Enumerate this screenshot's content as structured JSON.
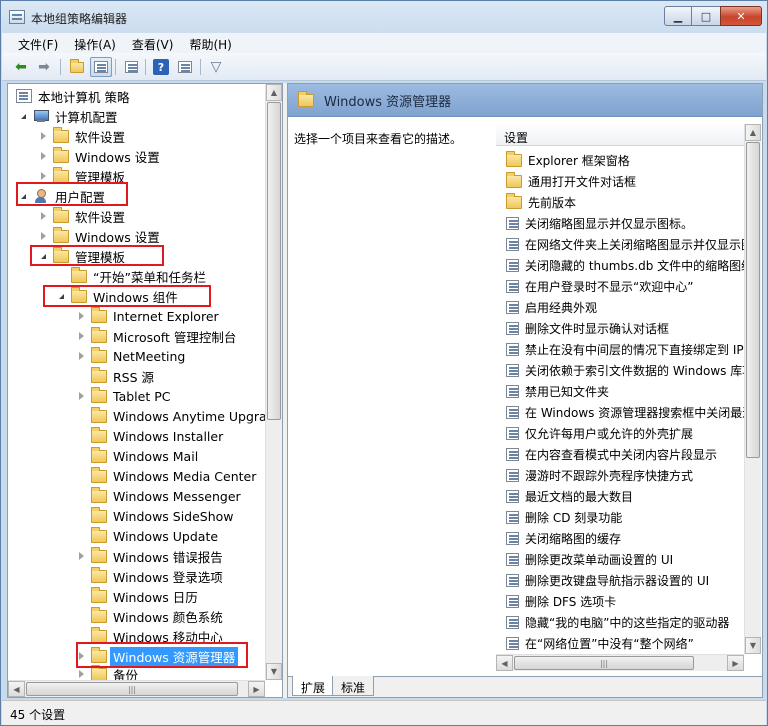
{
  "window": {
    "title": "本地组策略编辑器"
  },
  "menu": [
    "文件(F)",
    "操作(A)",
    "查看(V)",
    "帮助(H)"
  ],
  "toolbar": {
    "icons": [
      "back-arrow-icon",
      "forward-arrow-icon",
      "up-folder-icon",
      "show-hide-tree-icon",
      "export-list-icon",
      "help-icon",
      "properties-icon",
      "filter-icon"
    ]
  },
  "tree": {
    "root": "本地计算机 策略",
    "computer_config": "计算机配置",
    "cc_software": "软件设置",
    "cc_windows": "Windows 设置",
    "cc_admin": "管理模板",
    "user_config": "用户配置",
    "uc_software": "软件设置",
    "uc_windows": "Windows 设置",
    "uc_admin": "管理模板",
    "start_menu": "“开始”菜单和任务栏",
    "win_components": "Windows 组件",
    "components": [
      "Internet Explorer",
      "Microsoft 管理控制台",
      "NetMeeting",
      "RSS 源",
      "Tablet PC",
      "Windows Anytime Upgrade",
      "Windows Installer",
      "Windows Mail",
      "Windows Media Center",
      "Windows Messenger",
      "Windows SideShow",
      "Windows Update",
      "Windows 错误报告",
      "Windows 登录选项",
      "Windows 日历",
      "Windows 颜色系统",
      "Windows 移动中心",
      "Windows 资源管理器",
      "备份"
    ]
  },
  "right": {
    "header_title": "Windows 资源管理器",
    "description": "选择一个项目来查看它的描述。",
    "column_header": "设置",
    "folders": [
      "Explorer 框架窗格",
      "通用打开文件对话框",
      "先前版本"
    ],
    "policies": [
      "关闭缩略图显示并仅显示图标。",
      "在网络文件夹上关闭缩略图显示并仅显示图",
      "关闭隐藏的 thumbs.db 文件中的缩略图缓存",
      "在用户登录时不显示“欢迎中心”",
      "启用经典外观",
      "删除文件时显示确认对话框",
      "禁止在没有中间层的情况下直接绑定到 IPr",
      "关闭依赖于索引文件数据的 Windows 库功",
      "禁用已知文件夹",
      "在 Windows 资源管理器搜索框中关闭最近",
      "仅允许每用户或允许的外壳扩展",
      "在内容查看模式中关闭内容片段显示",
      "漫游时不跟踪外壳程序快捷方式",
      "最近文档的最大数目",
      "删除 CD 刻录功能",
      "关闭缩略图的缓存",
      "删除更改菜单动画设置的 UI",
      "删除更改键盘导航指示器设置的 UI",
      "删除 DFS 选项卡",
      "隐藏“我的电脑”中的这些指定的驱动器",
      "在“网络位置”中没有“整个网络”"
    ]
  },
  "tabs": [
    "扩展",
    "标准"
  ],
  "status": "45 个设置"
}
